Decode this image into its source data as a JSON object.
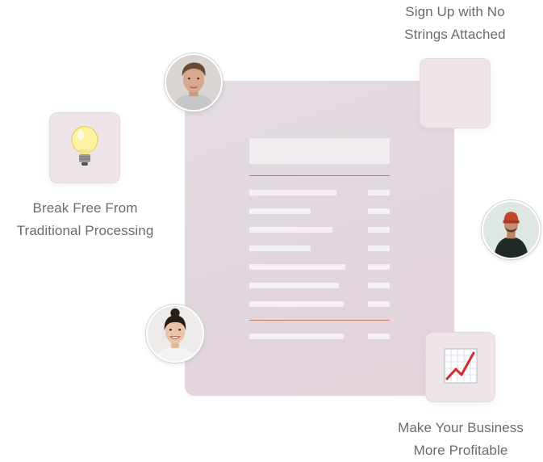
{
  "features": {
    "signup": {
      "line1": "Sign Up with No",
      "line2": "Strings Attached"
    },
    "break_free": {
      "line1": "Break Free From",
      "line2": "Traditional Processing",
      "icon": "lightbulb-icon"
    },
    "profitable": {
      "line1": "Make Your Business",
      "line2": "More Profitable",
      "icon": "chart-increasing-icon"
    }
  },
  "colors": {
    "panel": "#e3d9df",
    "rule": "#c97a62",
    "caption": "#6b6b6b",
    "tile": "#ede5ea"
  }
}
